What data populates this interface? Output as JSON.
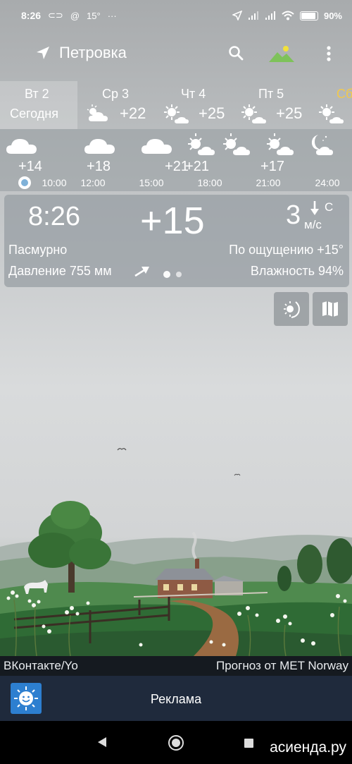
{
  "status_bar": {
    "time": "8:26",
    "icons": [
      "link-icon",
      "at-icon"
    ],
    "temp_badge": "15°",
    "more": "···",
    "right_icons": [
      "location-arrow-icon",
      "signal-icon",
      "signal-icon",
      "wifi-icon",
      "battery-icon"
    ],
    "battery_level": 0.9,
    "battery_text": "90%"
  },
  "app_bar": {
    "location": "Петровка",
    "icons": [
      "navigation-arrow-icon",
      "search-icon",
      "landscape-icon",
      "more-vert-icon"
    ]
  },
  "days": [
    {
      "name": "Вт 2",
      "sub": "Сегодня",
      "selected": true
    },
    {
      "name": "Ср 3",
      "temp": "+22",
      "icon": "cloud-icon"
    },
    {
      "name": "Чт 4",
      "temp": "+25",
      "icon": "sun-cloud-icon"
    },
    {
      "name": "Пт 5",
      "temp": "+25",
      "icon": "sun-cloud-icon"
    },
    {
      "name": "Сб",
      "icon": "sun-cloud-icon"
    }
  ],
  "hourly": [
    {
      "time": "10:00",
      "temp": "+14",
      "icon": "cloud-icon"
    },
    {
      "time": "12:00",
      "temp": "+18",
      "icon": "cloud-icon"
    },
    {
      "time": "15:00",
      "temp": "+21",
      "icon": "cloud-icon"
    },
    {
      "time": "18:00",
      "temp": "+21",
      "icon": "sun-cloud-icon"
    },
    {
      "time": "21:00",
      "temp": "+17",
      "icon": "sun-cloud-icon"
    },
    {
      "time": "24:00",
      "temp": "",
      "icon": "moon-cloud-icon"
    }
  ],
  "current": {
    "time": "8:26",
    "temp": "+15",
    "wind_speed": "3",
    "wind_dir": "С",
    "wind_unit": "м/с",
    "condition": "Пасмурно",
    "feels_like": "По ощущению +15°",
    "pressure": "Давление 755 мм",
    "humidity": "Влажность 94%"
  },
  "buttons": {
    "sun_moon": "sun-moon-icon",
    "map": "map-icon"
  },
  "credits": {
    "left": "ВКонтакте/Yo",
    "right": "Прогноз от MET Norway"
  },
  "ad": {
    "label": "Реклама",
    "icon": "yowindow-logo-icon"
  },
  "watermark": "асиенда.ру",
  "colors": {
    "sky": "#c4c7c9",
    "credits_bg": "#151a20",
    "ad_bg": "#1f2a3c",
    "accent": "#7fb1d8",
    "icon_yellow": "#f2e13a",
    "icon_green": "#7ec25a"
  }
}
